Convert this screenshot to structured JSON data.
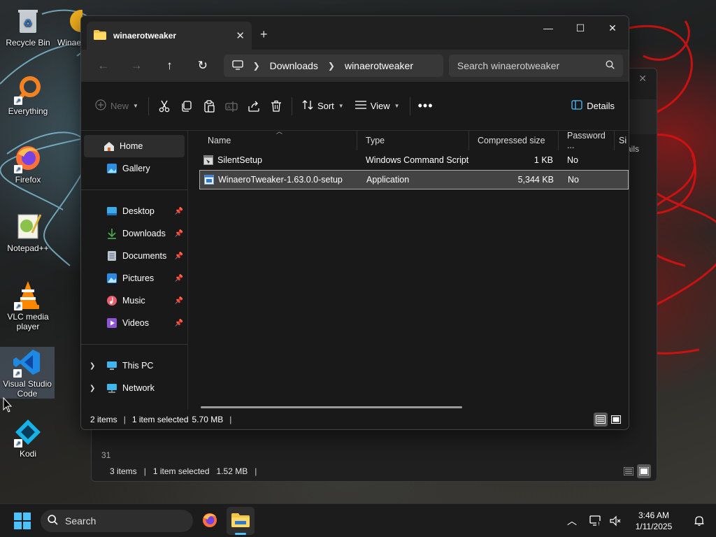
{
  "colors": {
    "accent": "#4cc2ff",
    "folder": "#f4c542",
    "window_bg": "#191919",
    "selection": "#434343"
  },
  "desktop": {
    "icons": [
      {
        "label": "Recycle Bin",
        "icon": "recycle-bin-icon"
      },
      {
        "label": "Winae",
        "icon": "winaero-icon"
      },
      {
        "label": "Everything",
        "icon": "everything-icon"
      },
      {
        "label": "Firefox",
        "icon": "firefox-icon"
      },
      {
        "label": "Notepad++",
        "icon": "notepad-plus-plus-icon"
      },
      {
        "label": "VLC media player",
        "icon": "vlc-icon"
      },
      {
        "label": "Visual Studio Code",
        "icon": "vscode-icon"
      },
      {
        "label": "Kodi",
        "icon": "kodi-icon"
      }
    ]
  },
  "back_window": {
    "status_items": "3 items",
    "status_selected": "1 item selected",
    "status_size": "1.52 MB",
    "network_label": "Network",
    "partial_number": "31",
    "partial_details": "ails"
  },
  "window": {
    "tab_title": "winaerotweaker",
    "search_placeholder": "Search winaerotweaker",
    "breadcrumb": [
      "Downloads",
      "winaerotweaker"
    ]
  },
  "commands": {
    "new": "New",
    "sort": "Sort",
    "view": "View",
    "details": "Details"
  },
  "nav": {
    "top": [
      {
        "label": "Home",
        "icon": "home-icon"
      },
      {
        "label": "Gallery",
        "icon": "gallery-icon"
      }
    ],
    "quick": [
      {
        "label": "Desktop",
        "icon": "desktop-icon"
      },
      {
        "label": "Downloads",
        "icon": "download-icon"
      },
      {
        "label": "Documents",
        "icon": "documents-icon"
      },
      {
        "label": "Pictures",
        "icon": "pictures-icon"
      },
      {
        "label": "Music",
        "icon": "music-icon"
      },
      {
        "label": "Videos",
        "icon": "videos-icon"
      }
    ],
    "bottom": [
      {
        "label": "This PC",
        "icon": "pc-icon"
      },
      {
        "label": "Network",
        "icon": "network-icon"
      }
    ]
  },
  "columns": {
    "name": "Name",
    "type": "Type",
    "size": "Compressed size",
    "password": "Password ...",
    "extra": "Si"
  },
  "files": [
    {
      "name": "SilentSetup",
      "type": "Windows Command Script",
      "size": "1 KB",
      "password": "No",
      "icon": "script-file-icon"
    },
    {
      "name": "WinaeroTweaker-1.63.0.0-setup",
      "type": "Application",
      "size": "5,344 KB",
      "password": "No",
      "icon": "application-file-icon"
    }
  ],
  "status": {
    "count": "2 items",
    "selected": "1 item selected",
    "size": "5.70 MB"
  },
  "taskbar": {
    "search_label": "Search",
    "time": "3:46 AM",
    "date": "1/11/2025"
  }
}
